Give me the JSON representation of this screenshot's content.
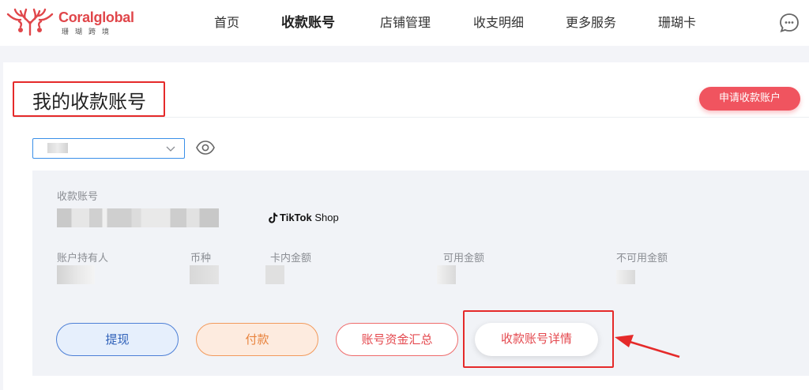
{
  "brand": {
    "name": "Coralglobal",
    "subtitle": "珊瑚跨境",
    "color": "#e0464a"
  },
  "nav": {
    "items": [
      {
        "label": "首页",
        "active": false
      },
      {
        "label": "收款账号",
        "active": true
      },
      {
        "label": "店铺管理",
        "active": false
      },
      {
        "label": "收支明细",
        "active": false
      },
      {
        "label": "更多服务",
        "active": false
      },
      {
        "label": "珊瑚卡",
        "active": false
      }
    ]
  },
  "page": {
    "title": "我的收款账号",
    "apply_button": "申请收款账户"
  },
  "account_selector": {
    "value": "■■■"
  },
  "account": {
    "number_label": "收款账号",
    "number_value": "■■■■■■■■■■■■■■■■",
    "platform": {
      "brand": "TikTok",
      "suffix": " Shop"
    },
    "holder_label": "账户持有人",
    "holder_value": "■■■",
    "currency_label": "币种",
    "currency_value": "■■",
    "card_balance_label": "卡内金额",
    "card_balance_value": "■",
    "available_label": "可用金额",
    "available_value": "■",
    "unavailable_label": "不可用金额",
    "unavailable_value": "■"
  },
  "actions": {
    "withdraw": "提现",
    "pay": "付款",
    "summary": "账号资金汇总",
    "detail": "收款账号详情"
  },
  "colors": {
    "accent": "#f0545f",
    "annotation": "#e52a2a",
    "select_border": "#3a8fe8"
  },
  "icons": [
    "coral-logo-icon",
    "chat-icon",
    "chevron-down-icon",
    "eye-icon",
    "tiktok-icon",
    "red-arrow-annotation"
  ]
}
